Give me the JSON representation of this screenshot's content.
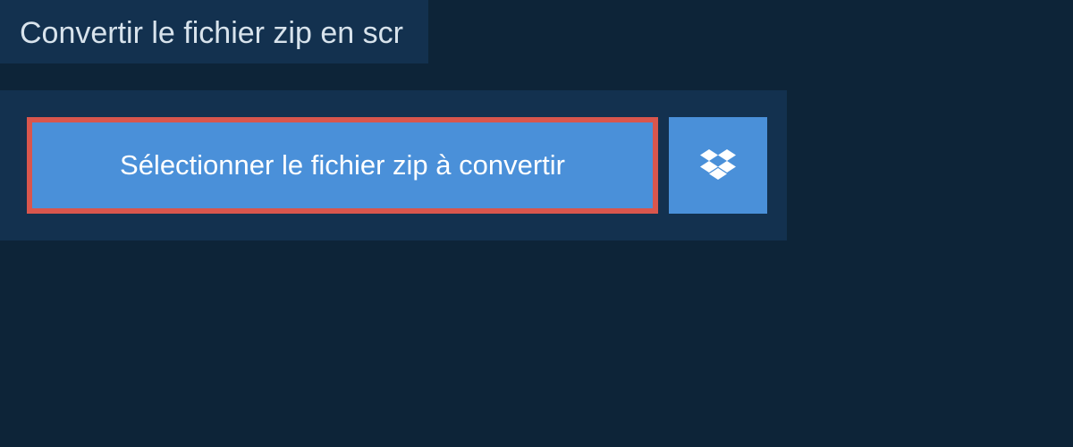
{
  "header": {
    "title": "Convertir le fichier zip en scr"
  },
  "actions": {
    "select_file_label": "Sélectionner le fichier zip à convertir"
  },
  "colors": {
    "background_dark": "#0d2438",
    "panel": "#13314f",
    "button_primary": "#4a90d9",
    "highlight_border": "#d9564d",
    "text_light": "#d8e3ec"
  }
}
